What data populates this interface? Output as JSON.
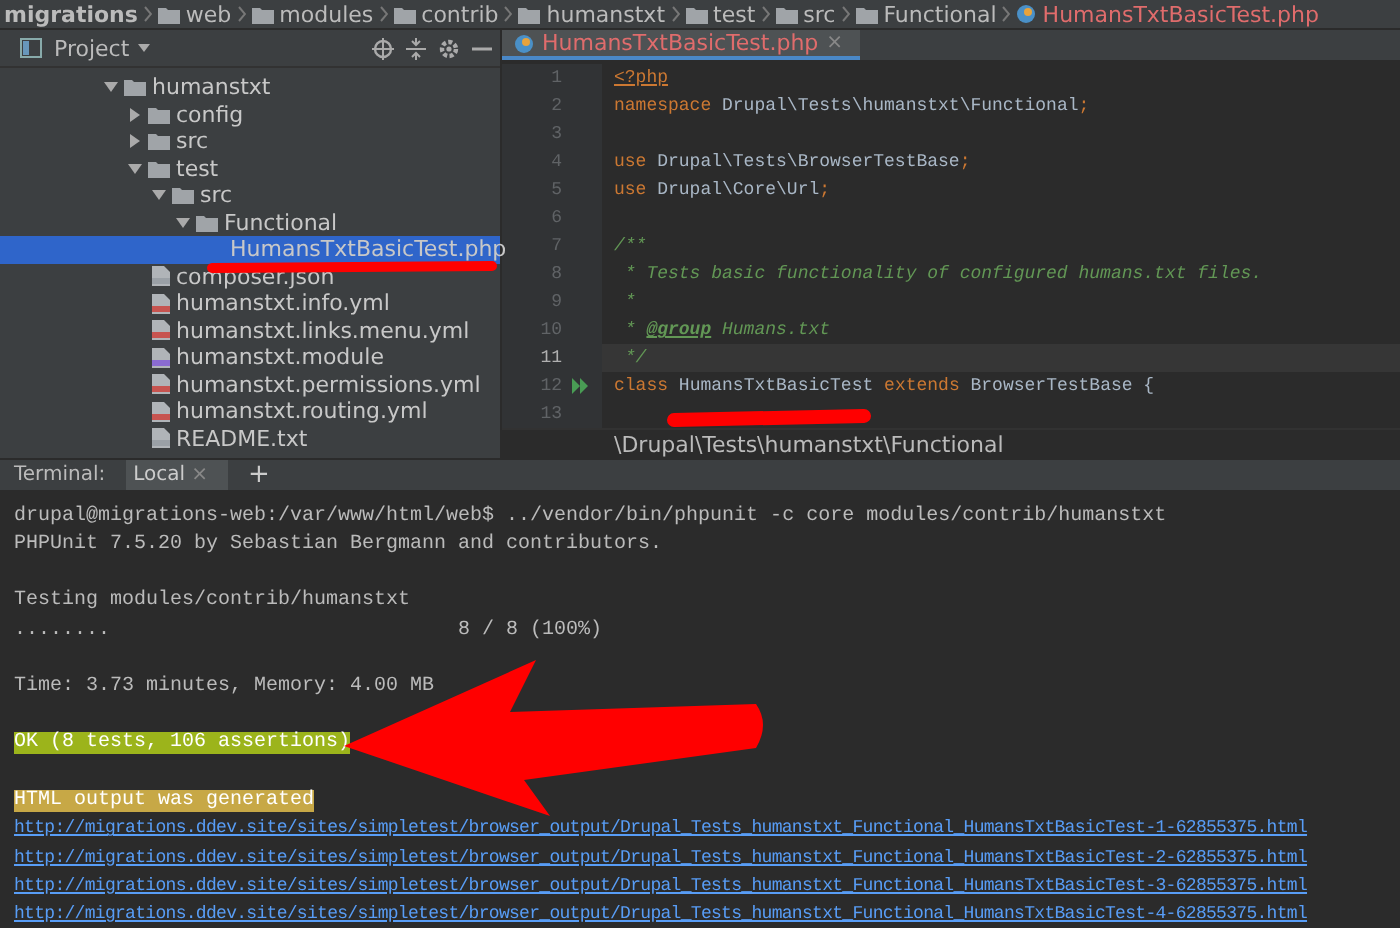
{
  "breadcrumb": [
    {
      "label": "migrations",
      "kind": "project"
    },
    {
      "label": "web",
      "kind": "folder"
    },
    {
      "label": "modules",
      "kind": "folder"
    },
    {
      "label": "contrib",
      "kind": "folder"
    },
    {
      "label": "humanstxt",
      "kind": "folder"
    },
    {
      "label": "test",
      "kind": "folder"
    },
    {
      "label": "src",
      "kind": "folder"
    },
    {
      "label": "Functional",
      "kind": "folder"
    },
    {
      "label": "HumansTxtBasicTest.php",
      "kind": "php"
    }
  ],
  "project_panel": {
    "title": "Project",
    "tree": [
      {
        "label": "humanstxt",
        "kind": "folder",
        "expanded": true,
        "selected": false,
        "children": [
          {
            "label": "config",
            "kind": "folder",
            "expanded": false,
            "selected": false
          },
          {
            "label": "src",
            "kind": "folder",
            "expanded": false,
            "selected": false
          },
          {
            "label": "test",
            "kind": "folder",
            "expanded": true,
            "selected": false,
            "children": [
              {
                "label": "src",
                "kind": "folder",
                "expanded": true,
                "selected": false,
                "children": [
                  {
                    "label": "Functional",
                    "kind": "folder",
                    "expanded": true,
                    "selected": false,
                    "children": [
                      {
                        "label": "HumansTxtBasicTest.php",
                        "kind": "php",
                        "selected": true
                      }
                    ]
                  }
                ]
              }
            ]
          },
          {
            "label": "composer.json",
            "kind": "json",
            "selected": false
          },
          {
            "label": "humanstxt.info.yml",
            "kind": "yml",
            "selected": false
          },
          {
            "label": "humanstxt.links.menu.yml",
            "kind": "yml",
            "selected": false
          },
          {
            "label": "humanstxt.module",
            "kind": "module",
            "selected": false
          },
          {
            "label": "humanstxt.permissions.yml",
            "kind": "yml",
            "selected": false
          },
          {
            "label": "humanstxt.routing.yml",
            "kind": "yml",
            "selected": false
          },
          {
            "label": "README.txt",
            "kind": "txt",
            "selected": false
          }
        ]
      }
    ]
  },
  "editor": {
    "tab": {
      "label": "HumansTxtBasicTest.php",
      "close": "×"
    },
    "lines": [
      {
        "number": "1",
        "current": false,
        "parts": [
          {
            "text": "<?php",
            "kind": "tag"
          }
        ]
      },
      {
        "number": "2",
        "current": false,
        "parts": [
          {
            "text": "namespace",
            "kind": "keyword"
          },
          {
            "text": " Drupal\\Tests\\humanstxt\\Functional",
            "kind": "plain"
          },
          {
            "text": ";",
            "kind": "keyword"
          }
        ]
      },
      {
        "number": "3",
        "current": false
      },
      {
        "number": "4",
        "current": false,
        "parts": [
          {
            "text": "use",
            "kind": "keyword"
          },
          {
            "text": " Drupal\\Tests\\BrowserTestBase",
            "kind": "plain"
          },
          {
            "text": ";",
            "kind": "keyword"
          }
        ]
      },
      {
        "number": "5",
        "current": false,
        "parts": [
          {
            "text": "use",
            "kind": "keyword"
          },
          {
            "text": " Drupal\\Core\\Url",
            "kind": "plain"
          },
          {
            "text": ";",
            "kind": "keyword"
          }
        ]
      },
      {
        "number": "6",
        "current": false
      },
      {
        "number": "7",
        "current": false,
        "parts": [
          {
            "text": "/**",
            "kind": "comment"
          }
        ]
      },
      {
        "number": "8",
        "current": false,
        "parts": [
          {
            "text": " * Tests basic functionality of configured humans.txt files.",
            "kind": "comment"
          }
        ]
      },
      {
        "number": "9",
        "current": false,
        "parts": [
          {
            "text": " *",
            "kind": "comment"
          }
        ]
      },
      {
        "number": "10",
        "current": false,
        "parts": [
          {
            "text": " * ",
            "kind": "comment"
          },
          {
            "text": "@group",
            "kind": "doctag"
          },
          {
            "text": " Humans.txt",
            "kind": "comment"
          }
        ]
      },
      {
        "number": "11",
        "current": true,
        "parts": [
          {
            "text": " */",
            "kind": "comment"
          }
        ]
      },
      {
        "number": "12",
        "current": false,
        "run": true,
        "parts": [
          {
            "text": "class",
            "kind": "keyword"
          },
          {
            "text": " HumansTxtBasicTest ",
            "kind": "plain"
          },
          {
            "text": "extends",
            "kind": "keyword"
          },
          {
            "text": " BrowserTestBase {",
            "kind": "plain"
          }
        ]
      },
      {
        "number": "13",
        "current": false
      }
    ],
    "footer": "\\Drupal\\Tests\\humanstxt\\Functional"
  },
  "terminal": {
    "label": "Terminal:",
    "tabs": [
      {
        "label": "Local",
        "close": "×",
        "selected": true
      }
    ],
    "add": "+",
    "lines": [
      {
        "kind": "plain",
        "text": "drupal@migrations-web:/var/www/html/web$ ../vendor/bin/phpunit -c core modules/contrib/humanstxt"
      },
      {
        "kind": "plain",
        "text": "PHPUnit 7.5.20 by Sebastian Bergmann and contributors."
      },
      {
        "kind": "blank"
      },
      {
        "kind": "plain",
        "text": "Testing modules/contrib/humanstxt"
      },
      {
        "kind": "progress",
        "text": "........",
        "count": "8 / 8 (100%)"
      },
      {
        "kind": "blank"
      },
      {
        "kind": "plain",
        "text": "Time: 3.73 minutes, Memory: 4.00 MB"
      },
      {
        "kind": "blank"
      },
      {
        "kind": "success",
        "text": "OK (8 tests, 106 assertions)"
      },
      {
        "kind": "blank"
      },
      {
        "kind": "warning",
        "text": "HTML output was generated"
      },
      {
        "kind": "link",
        "text": "http://migrations.ddev.site/sites/simpletest/browser_output/Drupal_Tests_humanstxt_Functional_HumansTxtBasicTest-1-62855375.html"
      },
      {
        "kind": "link",
        "text": "http://migrations.ddev.site/sites/simpletest/browser_output/Drupal_Tests_humanstxt_Functional_HumansTxtBasicTest-2-62855375.html"
      },
      {
        "kind": "link",
        "text": "http://migrations.ddev.site/sites/simpletest/browser_output/Drupal_Tests_humanstxt_Functional_HumansTxtBasicTest-3-62855375.html"
      },
      {
        "kind": "link",
        "text": "http://migrations.ddev.site/sites/simpletest/browser_output/Drupal_Tests_humanstxt_Functional_HumansTxtBasicTest-4-62855375.html"
      }
    ]
  }
}
